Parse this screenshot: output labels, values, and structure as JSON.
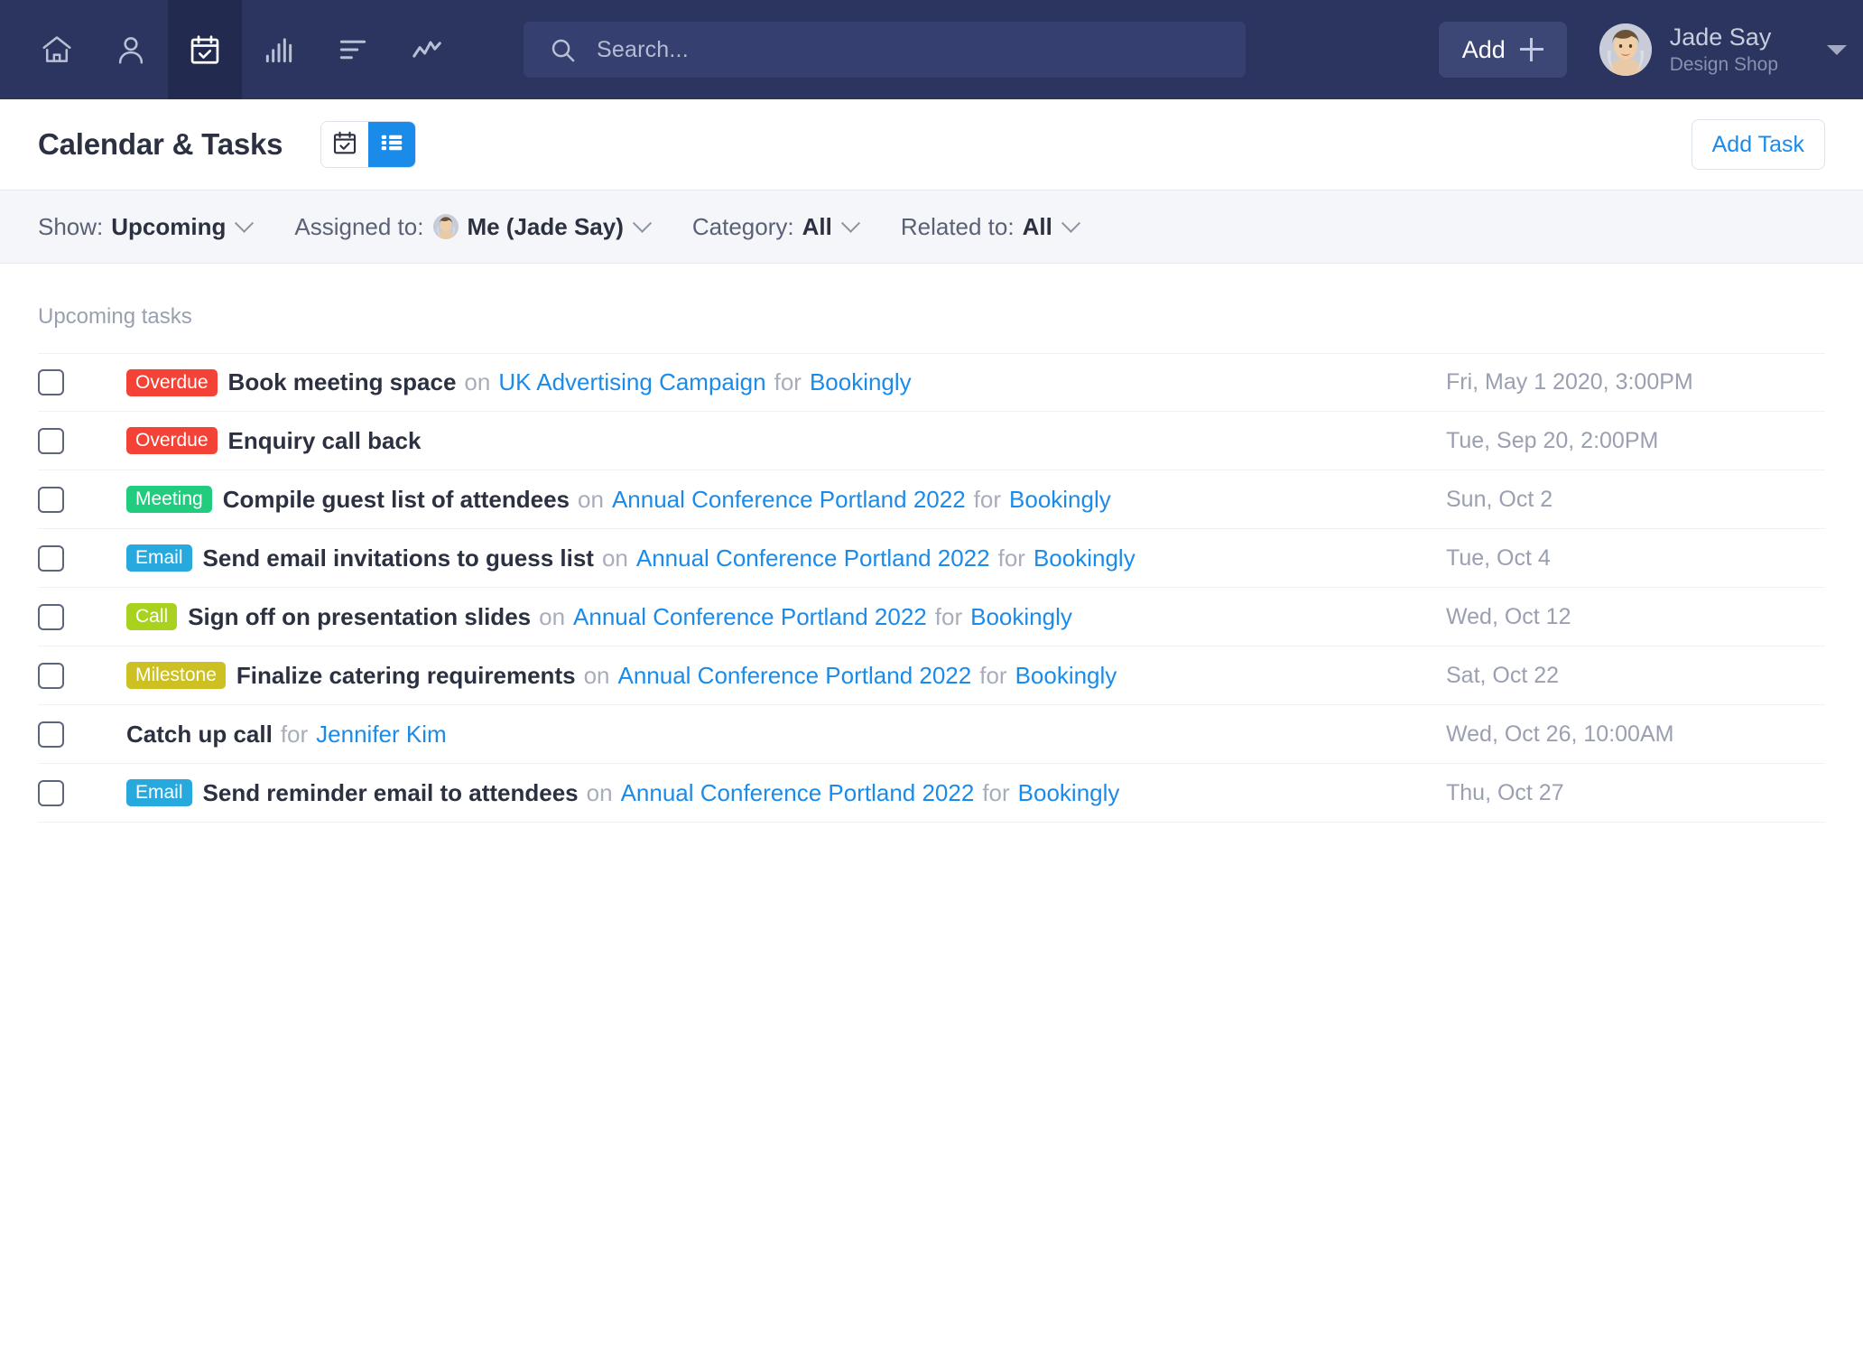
{
  "nav": {
    "icons": [
      {
        "name": "home-icon",
        "label": "Home",
        "active": false
      },
      {
        "name": "contacts-icon",
        "label": "Contacts",
        "active": false
      },
      {
        "name": "calendar-check-icon",
        "label": "Calendar & Tasks",
        "active": true
      },
      {
        "name": "bar-chart-icon",
        "label": "Reports",
        "active": false
      },
      {
        "name": "list-icon",
        "label": "Lists",
        "active": false
      },
      {
        "name": "activity-line-icon",
        "label": "Activity",
        "active": false
      }
    ],
    "search": {
      "placeholder": "Search...",
      "value": "",
      "icon": "search-icon"
    },
    "add_button": {
      "label": "Add",
      "icon": "plus-icon"
    },
    "user": {
      "name": "Jade Say",
      "org": "Design Shop",
      "avatar": "user-avatar",
      "caret": "chevron-down-icon"
    }
  },
  "header": {
    "title": "Calendar & Tasks",
    "view_toggle": [
      {
        "name": "calendar-view-button",
        "icon": "calendar-check-icon",
        "active": false
      },
      {
        "name": "list-view-button",
        "icon": "list-view-icon",
        "active": true
      }
    ],
    "add_task_label": "Add Task"
  },
  "filters": [
    {
      "label": "Show:",
      "value": "Upcoming",
      "avatar": false
    },
    {
      "label": "Assigned to:",
      "value": "Me (Jade Say)",
      "avatar": true
    },
    {
      "label": "Category:",
      "value": "All",
      "avatar": false
    },
    {
      "label": "Related to:",
      "value": "All",
      "avatar": false
    }
  ],
  "list": {
    "section_title": "Upcoming tasks",
    "colors": {
      "overdue": "#f44336",
      "meeting": "#22cc7f",
      "email": "#28a9dd",
      "call": "#a8d21e",
      "milestone": "#ccc023",
      "link": "#1b8bea",
      "accent": "#1b8bea",
      "navbar": "#2b3560"
    },
    "tasks": [
      {
        "badge": "Overdue",
        "badge_type": "overdue",
        "title": "Book meeting space",
        "conn1": "on",
        "project": "UK Advertising Campaign",
        "conn2": "for",
        "company": "Bookingly",
        "date": "Fri, May 1 2020, 3:00PM",
        "checked": false
      },
      {
        "badge": "Overdue",
        "badge_type": "overdue",
        "title": "Enquiry call back",
        "conn1": "",
        "project": "",
        "conn2": "",
        "company": "",
        "date": "Tue, Sep 20, 2:00PM",
        "checked": false
      },
      {
        "badge": "Meeting",
        "badge_type": "meeting",
        "title": "Compile guest list of attendees",
        "conn1": "on",
        "project": "Annual Conference Portland 2022",
        "conn2": "for",
        "company": "Bookingly",
        "date": "Sun, Oct 2",
        "checked": false
      },
      {
        "badge": "Email",
        "badge_type": "email",
        "title": "Send email invitations to guess list",
        "conn1": "on",
        "project": "Annual Conference Portland 2022",
        "conn2": "for",
        "company": "Bookingly",
        "date": "Tue, Oct 4",
        "checked": false
      },
      {
        "badge": "Call",
        "badge_type": "call",
        "title": "Sign off on presentation slides",
        "conn1": "on",
        "project": "Annual Conference Portland 2022",
        "conn2": "for",
        "company": "Bookingly",
        "date": "Wed, Oct 12",
        "checked": false
      },
      {
        "badge": "Milestone",
        "badge_type": "milestone",
        "title": "Finalize catering requirements",
        "conn1": "on",
        "project": "Annual Conference Portland 2022",
        "conn2": "for",
        "company": "Bookingly",
        "date": "Sat, Oct 22",
        "checked": false
      },
      {
        "badge": "",
        "badge_type": "",
        "title": "Catch up call",
        "conn1": "",
        "project": "",
        "conn2": "for",
        "company": "Jennifer Kim",
        "date": "Wed, Oct 26, 10:00AM",
        "checked": false
      },
      {
        "badge": "Email",
        "badge_type": "email",
        "title": "Send reminder email to attendees",
        "conn1": "on",
        "project": "Annual Conference Portland 2022",
        "conn2": "for",
        "company": "Bookingly",
        "date": "Thu, Oct 27",
        "checked": false
      }
    ]
  }
}
